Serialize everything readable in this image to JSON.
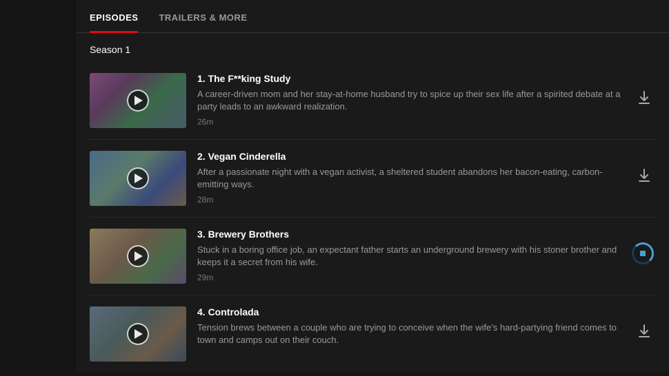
{
  "tabs": [
    {
      "id": "episodes",
      "label": "EPISODES",
      "active": true
    },
    {
      "id": "trailers",
      "label": "TRAILERS & MORE",
      "active": false
    }
  ],
  "season_label": "Season 1",
  "episodes": [
    {
      "number": "1",
      "title": "1. The F**king Study",
      "description": "A career-driven mom and her stay-at-home husband try to spice up their sex life after a spirited debate at a party leads to an awkward realization.",
      "duration": "26m",
      "download_state": "available",
      "thumbnail_class": "thumbnail-bg-1"
    },
    {
      "number": "2",
      "title": "2. Vegan Cinderella",
      "description": "After a passionate night with a vegan activist, a sheltered student abandons her bacon-eating, carbon-emitting ways.",
      "duration": "28m",
      "download_state": "available",
      "thumbnail_class": "thumbnail-bg-2"
    },
    {
      "number": "3",
      "title": "3. Brewery Brothers",
      "description": "Stuck in a boring office job, an expectant father starts an underground brewery with his stoner brother and keeps it a secret from his wife.",
      "duration": "29m",
      "download_state": "downloading",
      "thumbnail_class": "thumbnail-bg-3"
    },
    {
      "number": "4",
      "title": "4. Controlada",
      "description": "Tension brews between a couple who are trying to conceive when the wife's hard-partying friend comes to town and camps out on their couch.",
      "duration": "",
      "download_state": "available",
      "thumbnail_class": "thumbnail-bg-4"
    }
  ],
  "colors": {
    "active_tab_border": "#e50914",
    "download_icon": "#aaaaaa",
    "downloading_color": "#4a9fd4"
  }
}
